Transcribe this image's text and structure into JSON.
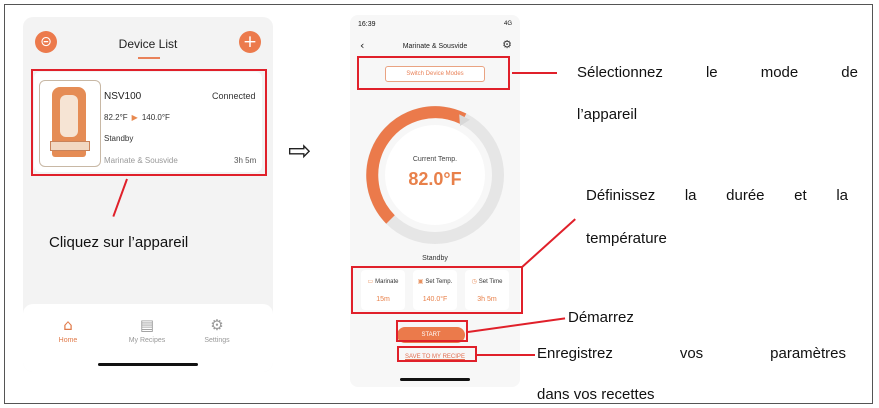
{
  "left_screen": {
    "title": "Device List",
    "scan_icon": "⊝",
    "add_icon": "+",
    "device": {
      "name": "NSV100",
      "status": "Connected",
      "current_temp": "82.2°F",
      "target_temp": "140.0°F",
      "state": "Standby",
      "mode": "Marinate & Sousvide",
      "time": "3h 5m"
    },
    "tabs": [
      {
        "label": "Home",
        "icon": "⌂"
      },
      {
        "label": "My Recipes",
        "icon": "▤"
      },
      {
        "label": "Settings",
        "icon": "⚙"
      }
    ]
  },
  "right_screen": {
    "status_time": "16:39",
    "status_icons": "4G",
    "title": "Marinate & Sousvide",
    "mode_button": "Switch Device Modes",
    "gauge_label": "Current Temp.",
    "gauge_value": "82.0°F",
    "gauge_fill": 0.6,
    "state": "Standby",
    "settings": [
      {
        "label": "Marinate",
        "value": "15m",
        "icon": "▭"
      },
      {
        "label": "Set Temp.",
        "value": "140.0°F",
        "icon": "▣"
      },
      {
        "label": "Set Time",
        "value": "3h 5m",
        "icon": "◷"
      }
    ],
    "start_button": "START",
    "save_link": "SAVE TO MY RECIPE"
  },
  "captions": {
    "tap_device": "Cliquez sur l’appareil",
    "select_mode_1": "Sélectionnez le mode de",
    "select_mode_2": "l’appareil",
    "set_time_temp_1": "Définissez la durée et la",
    "set_time_temp_2": "température",
    "start": "Démarrez",
    "save_1": "Enregistrez vos paramètres",
    "save_2": "dans vos recettes"
  },
  "arrow_glyph": "⇨",
  "colors": {
    "accent": "#eb7a4b",
    "annotation": "#e0202a"
  }
}
